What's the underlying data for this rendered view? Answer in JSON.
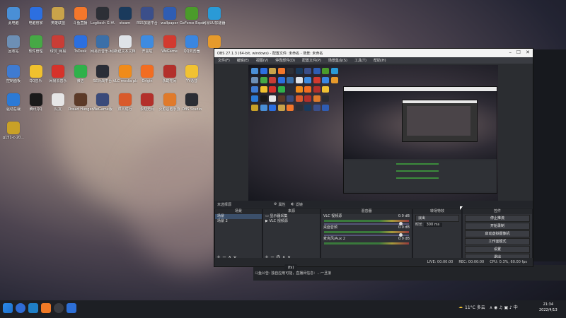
{
  "desktop": {
    "icons": [
      {
        "label": "此电脑",
        "color": "#4a8fd6"
      },
      {
        "label": "电脑管家",
        "color": "#2c6fe0"
      },
      {
        "label": "英雄联盟",
        "color": "#c9a34a"
      },
      {
        "label": "斗鱼直播",
        "color": "#f3772b"
      },
      {
        "label": "Logitech G HUB",
        "color": "#2d2f36"
      },
      {
        "label": "steam",
        "color": "#1a3a5c"
      },
      {
        "label": "RS5加速平台",
        "color": "#3b4f8a"
      },
      {
        "label": "wallpaper",
        "color": "#2f5db3"
      },
      {
        "label": "GeForce Experience",
        "color": "#4b9b2b"
      },
      {
        "label": "网易UU加速器",
        "color": "#2a9ad6"
      },
      {
        "label": "回收站",
        "color": "#6d8fb5"
      },
      {
        "label": "软件管理",
        "color": "#46a845"
      },
      {
        "label": "球员_网易",
        "color": "#c93d36"
      },
      {
        "label": "ToDesk",
        "color": "#2b6fe0"
      },
      {
        "label": "网易云音乐-网易大神",
        "color": "#3b6fa8"
      },
      {
        "label": "新建文本文档",
        "color": "#dfe3e8"
      },
      {
        "label": "开黑啦",
        "color": "#3e8be0"
      },
      {
        "label": "WeGame",
        "color": "#d33a2f"
      },
      {
        "label": "QQ浏览器",
        "color": "#3a86e0"
      },
      {
        "label": "",
        "color": "#e69a2b"
      },
      {
        "label": "控制面板",
        "color": "#3f7bd1"
      },
      {
        "label": "QQ音乐",
        "color": "#f0c12e"
      },
      {
        "label": "网易云音乐",
        "color": "#d6322a"
      },
      {
        "label": "微信",
        "color": "#2fb14a"
      },
      {
        "label": "5E对战平台",
        "color": "#2a2d36"
      },
      {
        "label": "VLC media player",
        "color": "#f08b1a"
      },
      {
        "label": "Origin",
        "color": "#f26d21"
      },
      {
        "label": "永劫无间",
        "color": "#b3302b"
      },
      {
        "label": "YY语音",
        "color": "#f1c232"
      },
      {
        "label": "驱动总裁",
        "color": "#2b7ad6"
      },
      {
        "label": "腾讯QQ",
        "color": "#1a1a1a"
      },
      {
        "label": "队友",
        "color": "#e6e6e6"
      },
      {
        "label": "Dread Hunger",
        "color": "#5c3a28"
      },
      {
        "label": "WeGame版",
        "color": "#3a4a7a"
      },
      {
        "label": "双人成行",
        "color": "#d95a2b"
      },
      {
        "label": "永劫无间",
        "color": "#b3302b"
      },
      {
        "label": "火影忍者手游",
        "color": "#e07a2b"
      },
      {
        "label": "OBS Studio",
        "color": "#2b2d34"
      },
      {
        "label": "g151-c-20...",
        "color": "#c9a127"
      }
    ]
  },
  "obs": {
    "title": "OBS 27.1.3 (64-bit, windows) - 配置文件: 未命名 - 场景: 未命名",
    "menu": [
      "文件(F)",
      "编辑(E)",
      "视图(V)",
      "停靠部件(D)",
      "配置文件(P)",
      "场景集合(S)",
      "工具(T)",
      "帮助(H)"
    ],
    "source_bar": {
      "label": "未选择源",
      "props": "属性",
      "filters": "滤镜"
    },
    "panels": {
      "scenes": {
        "header": "场景",
        "items": [
          "场景",
          "场景 2"
        ]
      },
      "sources": {
        "header": "来源",
        "items": [
          "显示器采集",
          "VLC 视频源"
        ]
      },
      "mixer": {
        "header": "混音器",
        "channels": [
          {
            "name": "VLC 视频源",
            "db": "0.0 dB"
          },
          {
            "name": "桌面音频",
            "db": "0.0 dB"
          },
          {
            "name": "麦克风/Aux 2",
            "db": "0.0 dB"
          }
        ]
      },
      "transitions": {
        "header": "转场特效",
        "type": "淡出",
        "duration_label": "时长",
        "duration": "300 ms"
      },
      "controls": {
        "header": "控件",
        "buttons": [
          "停止推流",
          "开始录制",
          "启动虚拟摄像机",
          "工作室模式",
          "设置",
          "退出"
        ]
      }
    },
    "status": {
      "live": "LIVE: 00:00:00",
      "rec": "REC: 00:00:00",
      "cpu": "CPU: 0.3%, 60.00 fps"
    }
  },
  "notice": "斗鱼公告: 独自应用可能，直播间信息：...一旦接",
  "mpv_badge": "(fx)",
  "taskbar": {
    "weather": "11°C 多云",
    "time": "21:34",
    "date": "2022/4/13"
  }
}
